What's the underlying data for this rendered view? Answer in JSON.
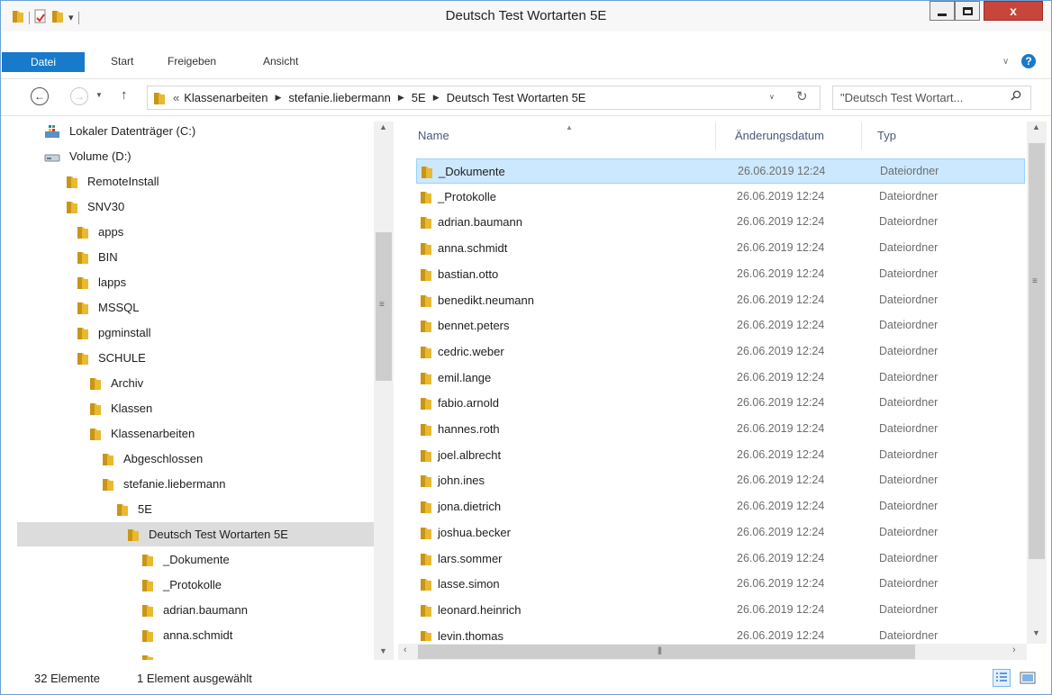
{
  "window": {
    "title": "Deutsch Test Wortarten 5E",
    "close_label": "x"
  },
  "ribbon": {
    "tabs": [
      "Datei",
      "Start",
      "Freigeben",
      "Ansicht"
    ],
    "help_label": "?"
  },
  "address": {
    "overflow": "«",
    "crumbs": [
      "Klassenarbeiten",
      "stefanie.liebermann",
      "5E",
      "Deutsch Test Wortarten 5E"
    ],
    "search_placeholder": "\"Deutsch Test Wortart..."
  },
  "nav_tree": [
    {
      "label": "Lokaler Datenträger (C:)",
      "icon": "drive-icon",
      "level": 0
    },
    {
      "label": "Volume (D:)",
      "icon": "drive-icon",
      "level": 0
    },
    {
      "label": "RemoteInstall",
      "icon": "folder-icon",
      "level": 1
    },
    {
      "label": "SNV30",
      "icon": "folder-icon",
      "level": 1
    },
    {
      "label": "apps",
      "icon": "folder-icon",
      "level": 2
    },
    {
      "label": "BIN",
      "icon": "folder-icon",
      "level": 2
    },
    {
      "label": "lapps",
      "icon": "folder-icon",
      "level": 2
    },
    {
      "label": "MSSQL",
      "icon": "folder-icon",
      "level": 2
    },
    {
      "label": "pgminstall",
      "icon": "folder-icon",
      "level": 2
    },
    {
      "label": "SCHULE",
      "icon": "folder-icon",
      "level": 2
    },
    {
      "label": "Archiv",
      "icon": "folder-icon",
      "level": 3
    },
    {
      "label": "Klassen",
      "icon": "folder-icon",
      "level": 3
    },
    {
      "label": "Klassenarbeiten",
      "icon": "folder-icon",
      "level": 3
    },
    {
      "label": "Abgeschlossen",
      "icon": "folder-icon",
      "level": 4
    },
    {
      "label": "stefanie.liebermann",
      "icon": "folder-icon",
      "level": 4
    },
    {
      "label": "5E",
      "icon": "folder-icon",
      "level": 5
    },
    {
      "label": "Deutsch Test Wortarten 5E",
      "icon": "folder-icon",
      "level": 6,
      "selected": true
    },
    {
      "label": "_Dokumente",
      "icon": "folder-icon",
      "level": 7
    },
    {
      "label": "_Protokolle",
      "icon": "folder-icon",
      "level": 7
    },
    {
      "label": "adrian.baumann",
      "icon": "folder-icon",
      "level": 7
    },
    {
      "label": "anna.schmidt",
      "icon": "folder-icon",
      "level": 7
    },
    {
      "label": "",
      "icon": "folder-icon",
      "level": 7
    }
  ],
  "columns": {
    "name": "Name",
    "date": "Änderungsdatum",
    "type": "Typ"
  },
  "files": [
    {
      "name": "_Dokumente",
      "date": "26.06.2019 12:24",
      "type": "Dateiordner",
      "selected": true
    },
    {
      "name": "_Protokolle",
      "date": "26.06.2019 12:24",
      "type": "Dateiordner"
    },
    {
      "name": "adrian.baumann",
      "date": "26.06.2019 12:24",
      "type": "Dateiordner"
    },
    {
      "name": "anna.schmidt",
      "date": "26.06.2019 12:24",
      "type": "Dateiordner"
    },
    {
      "name": "bastian.otto",
      "date": "26.06.2019 12:24",
      "type": "Dateiordner"
    },
    {
      "name": "benedikt.neumann",
      "date": "26.06.2019 12:24",
      "type": "Dateiordner"
    },
    {
      "name": "bennet.peters",
      "date": "26.06.2019 12:24",
      "type": "Dateiordner"
    },
    {
      "name": "cedric.weber",
      "date": "26.06.2019 12:24",
      "type": "Dateiordner"
    },
    {
      "name": "emil.lange",
      "date": "26.06.2019 12:24",
      "type": "Dateiordner"
    },
    {
      "name": "fabio.arnold",
      "date": "26.06.2019 12:24",
      "type": "Dateiordner"
    },
    {
      "name": "hannes.roth",
      "date": "26.06.2019 12:24",
      "type": "Dateiordner"
    },
    {
      "name": "joel.albrecht",
      "date": "26.06.2019 12:24",
      "type": "Dateiordner"
    },
    {
      "name": "john.ines",
      "date": "26.06.2019 12:24",
      "type": "Dateiordner"
    },
    {
      "name": "jona.dietrich",
      "date": "26.06.2019 12:24",
      "type": "Dateiordner"
    },
    {
      "name": "joshua.becker",
      "date": "26.06.2019 12:24",
      "type": "Dateiordner"
    },
    {
      "name": "lars.sommer",
      "date": "26.06.2019 12:24",
      "type": "Dateiordner"
    },
    {
      "name": "lasse.simon",
      "date": "26.06.2019 12:24",
      "type": "Dateiordner"
    },
    {
      "name": "leonard.heinrich",
      "date": "26.06.2019 12:24",
      "type": "Dateiordner"
    },
    {
      "name": "levin.thomas",
      "date": "26.06.2019 12:24",
      "type": "Dateiordner"
    }
  ],
  "status": {
    "count": "32 Elemente",
    "selection": "1 Element ausgewählt"
  },
  "colors": {
    "accent": "#1979ca",
    "selection_bg": "#cce8ff",
    "folder": "#e8b931",
    "close": "#c8453b"
  }
}
